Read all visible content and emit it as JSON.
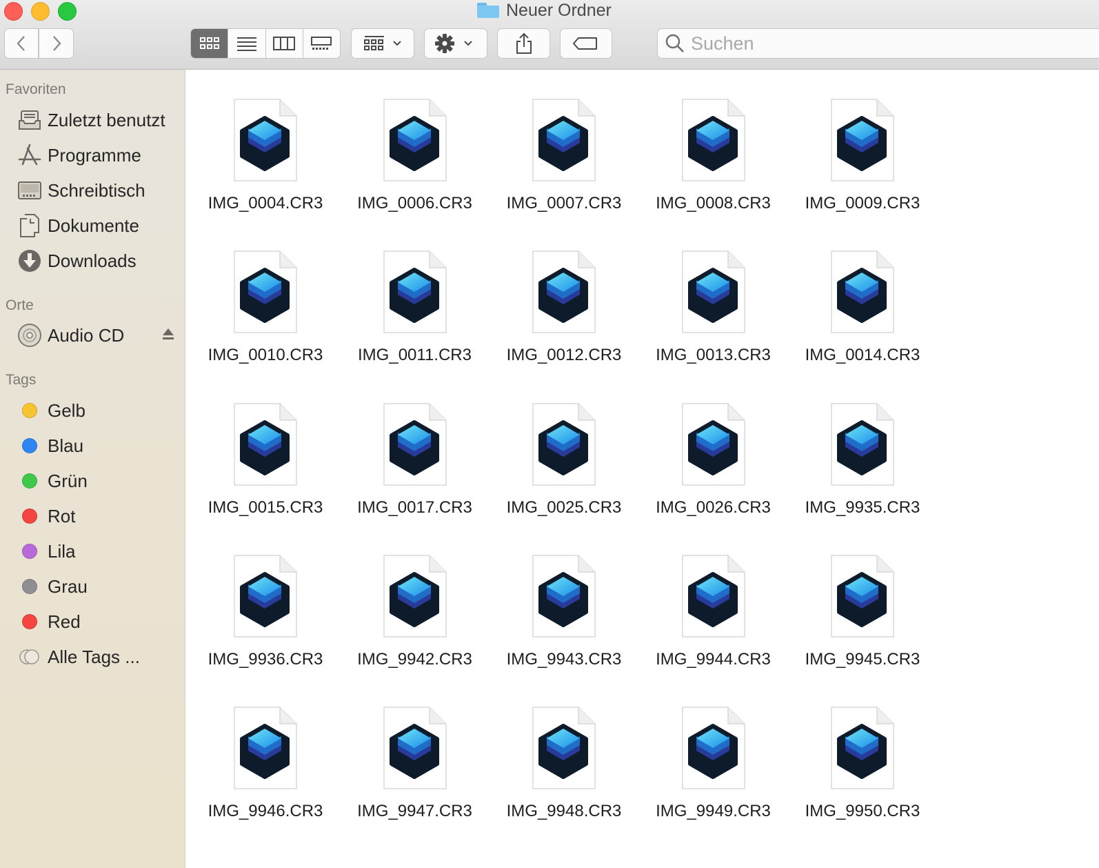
{
  "window": {
    "title": "Neuer Ordner"
  },
  "toolbar": {
    "back": "back",
    "forward": "forward",
    "views": [
      "icon-view",
      "list-view",
      "column-view",
      "gallery-view"
    ],
    "active_view": 0,
    "search_placeholder": "Suchen"
  },
  "sidebar": {
    "favorites_header": "Favoriten",
    "favorites": [
      {
        "label": "Zuletzt benutzt",
        "icon": "recents-icon"
      },
      {
        "label": "Programme",
        "icon": "applications-icon"
      },
      {
        "label": "Schreibtisch",
        "icon": "desktop-icon"
      },
      {
        "label": "Dokumente",
        "icon": "documents-icon"
      },
      {
        "label": "Downloads",
        "icon": "downloads-icon"
      }
    ],
    "locations_header": "Orte",
    "locations": [
      {
        "label": "Audio CD",
        "icon": "cd-icon"
      }
    ],
    "tags_header": "Tags",
    "tags": [
      {
        "label": "Gelb",
        "color": "#f7c431"
      },
      {
        "label": "Blau",
        "color": "#2e86f5"
      },
      {
        "label": "Grün",
        "color": "#3fc94a"
      },
      {
        "label": "Rot",
        "color": "#f44540"
      },
      {
        "label": "Lila",
        "color": "#b86ad8"
      },
      {
        "label": "Grau",
        "color": "#8e8e93"
      },
      {
        "label": "Red",
        "color": "#f44540"
      },
      {
        "label": "Alle Tags ...",
        "color": ""
      }
    ]
  },
  "files": [
    "IMG_0004.CR3",
    "IMG_0006.CR3",
    "IMG_0007.CR3",
    "IMG_0008.CR3",
    "IMG_0009.CR3",
    "IMG_0010.CR3",
    "IMG_0011.CR3",
    "IMG_0012.CR3",
    "IMG_0013.CR3",
    "IMG_0014.CR3",
    "IMG_0015.CR3",
    "IMG_0017.CR3",
    "IMG_0025.CR3",
    "IMG_0026.CR3",
    "IMG_9935.CR3",
    "IMG_9936.CR3",
    "IMG_9942.CR3",
    "IMG_9943.CR3",
    "IMG_9944.CR3",
    "IMG_9945.CR3",
    "IMG_9946.CR3",
    "IMG_9947.CR3",
    "IMG_9948.CR3",
    "IMG_9949.CR3",
    "IMG_9950.CR3"
  ]
}
